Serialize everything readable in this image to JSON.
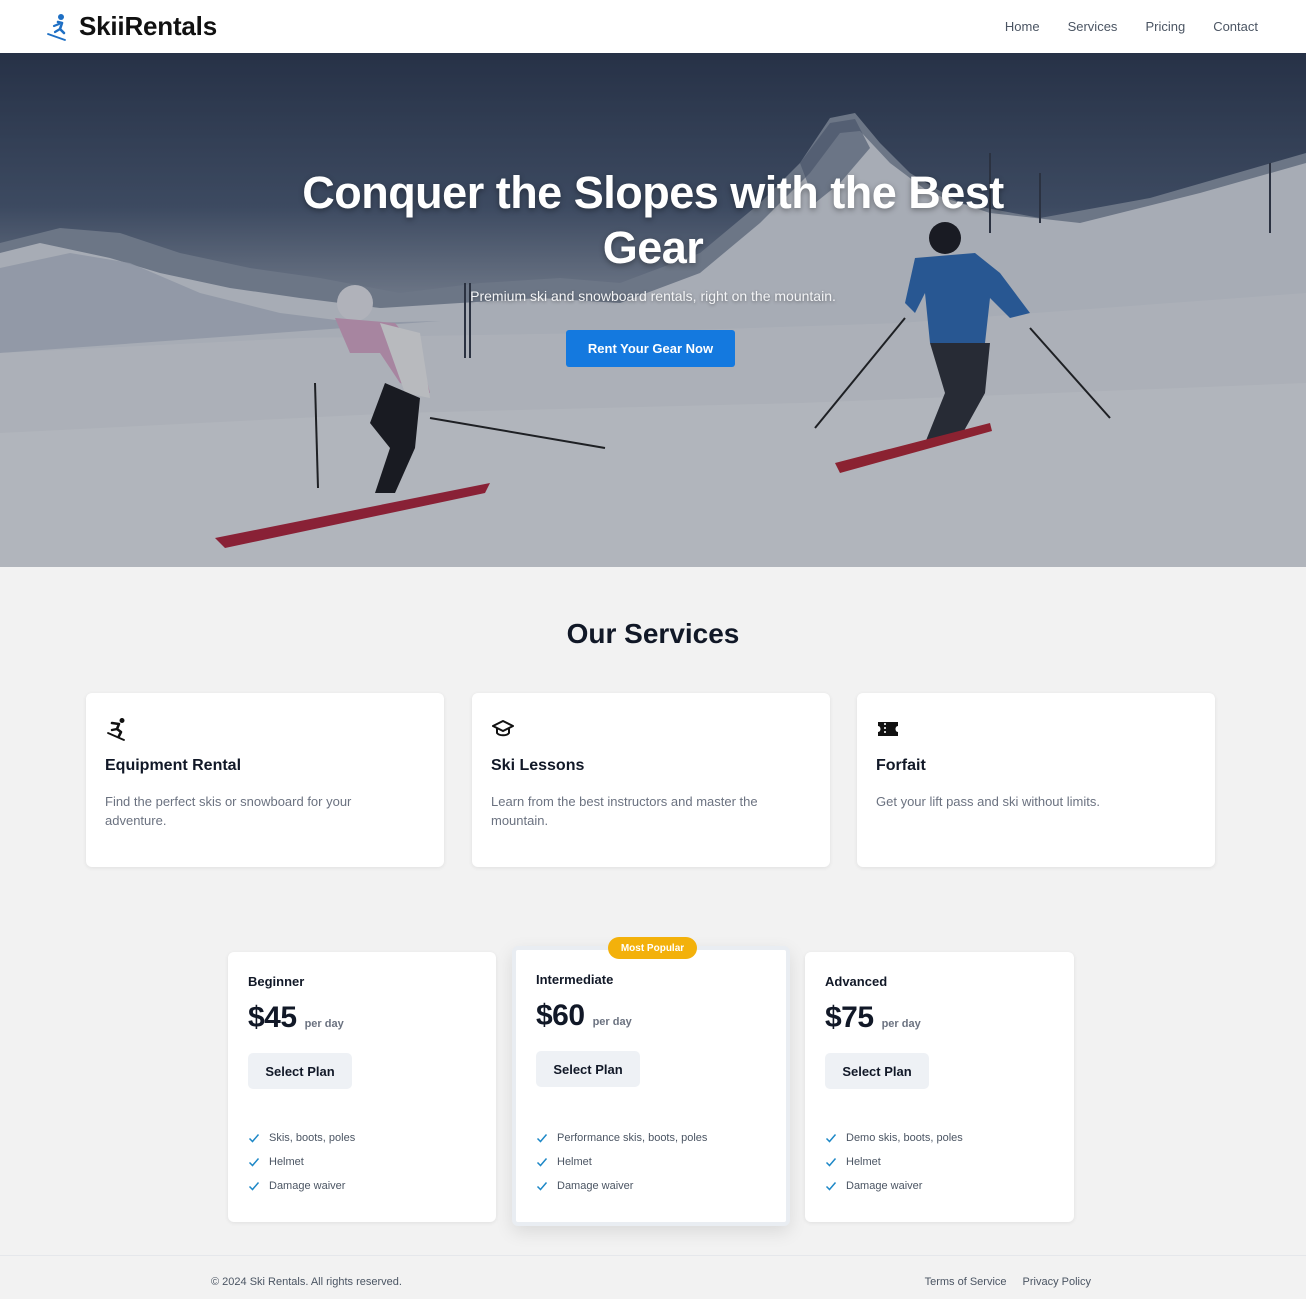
{
  "header": {
    "brand": "SkiiRentals",
    "nav": [
      "Home",
      "Services",
      "Pricing",
      "Contact"
    ]
  },
  "hero": {
    "title": "Conquer the Slopes with the Best Gear",
    "subtitle": "Premium ski and snowboard rentals, right on the mountain.",
    "cta": "Rent Your Gear Now"
  },
  "services": {
    "title": "Our Services",
    "items": [
      {
        "icon": "skier-icon",
        "title": "Equipment Rental",
        "desc": "Find the perfect skis or snowboard for your adventure."
      },
      {
        "icon": "graduation-cap-icon",
        "title": "Ski Lessons",
        "desc": "Learn from the best instructors and master the mountain."
      },
      {
        "icon": "ticket-icon",
        "title": "Forfait",
        "desc": "Get your lift pass and ski without limits."
      }
    ]
  },
  "pricing": {
    "plans": [
      {
        "name": "Beginner",
        "price": "$45",
        "unit": "per day",
        "button": "Select Plan",
        "features": [
          "Skis, boots, poles",
          "Helmet",
          "Damage waiver"
        ]
      },
      {
        "name": "Intermediate",
        "price": "$60",
        "unit": "per day",
        "button": "Select Plan",
        "badge": "Most Popular",
        "features": [
          "Performance skis, boots, poles",
          "Helmet",
          "Damage waiver"
        ]
      },
      {
        "name": "Advanced",
        "price": "$75",
        "unit": "per day",
        "button": "Select Plan",
        "features": [
          "Demo skis, boots, poles",
          "Helmet",
          "Damage waiver"
        ]
      }
    ]
  },
  "footer": {
    "copyright": "© 2024 Ski Rentals. All rights reserved.",
    "links": [
      "Terms of Service",
      "Privacy Policy"
    ]
  },
  "colors": {
    "accent": "#1479df",
    "badge": "#f3b10b",
    "check": "#1e88c7"
  }
}
